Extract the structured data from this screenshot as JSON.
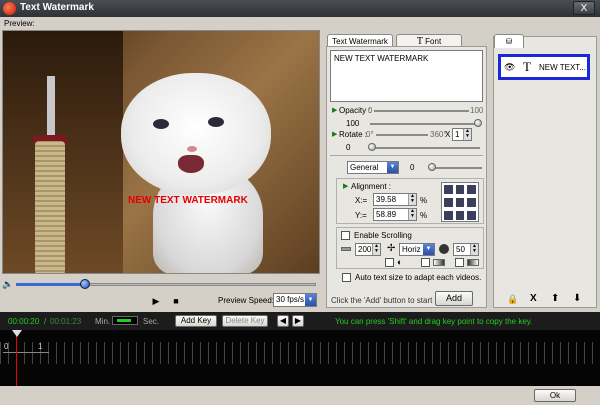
{
  "window": {
    "title": "Text Watermark",
    "close": "X"
  },
  "preview": {
    "label": "Preview:",
    "watermark_text": "NEW TEXT WATERMARK",
    "seek_progress": 0.23
  },
  "playback": {
    "play": "▶",
    "stop": "■",
    "speed_label": "Preview Speed:",
    "speed_value": "30 fps/s"
  },
  "tabs": {
    "text_watermark": "Text Watermark",
    "font": "Font",
    "font_glyph": "T"
  },
  "text_input": {
    "value": "NEW TEXT WATERMARK"
  },
  "opacity": {
    "label": "Opacity :",
    "min": "0",
    "max": "100",
    "value": "100"
  },
  "rotate": {
    "label": "Rotate :",
    "min": "0°",
    "max": "360°",
    "mult": "X",
    "mult_value": "1",
    "value": "0"
  },
  "position_mode": {
    "value": "General",
    "slider_value": "0"
  },
  "alignment": {
    "label": "Alignment :",
    "x_label": "X:=",
    "x_value": "39.58",
    "y_label": "Y:=",
    "y_value": "58.89",
    "unit": "%"
  },
  "scrolling": {
    "label": "Enable Scrolling",
    "speed": "200",
    "direction": "Horiz",
    "duration": "50"
  },
  "auto_size": {
    "label": "Auto text size to adapt each videos."
  },
  "add_area": {
    "hint": "Click the 'Add' button to start ->",
    "button": "Add"
  },
  "watermark_list": {
    "items": [
      {
        "glyph": "T",
        "label": "NEW TEXT..."
      }
    ]
  },
  "list_actions": {
    "lock": "🔒",
    "delete": "X",
    "up": "⬆",
    "down": "⬇"
  },
  "timeline_bar": {
    "current_time": "00:00:20",
    "sep": "/",
    "total_time": "00:01:23",
    "min_label": "Min.",
    "sec_label": "Sec.",
    "add_key": "Add Key",
    "delete_key": "Delete Key",
    "hint": "You can press 'Shift' and drag key point to copy the key."
  },
  "timeline": {
    "tick_0": "0",
    "tick_1": "1"
  },
  "footer": {
    "ok": "Ok"
  },
  "colors": {
    "accent": "#1a28d8",
    "watermark": "#e60000",
    "hint": "#22cc22"
  }
}
